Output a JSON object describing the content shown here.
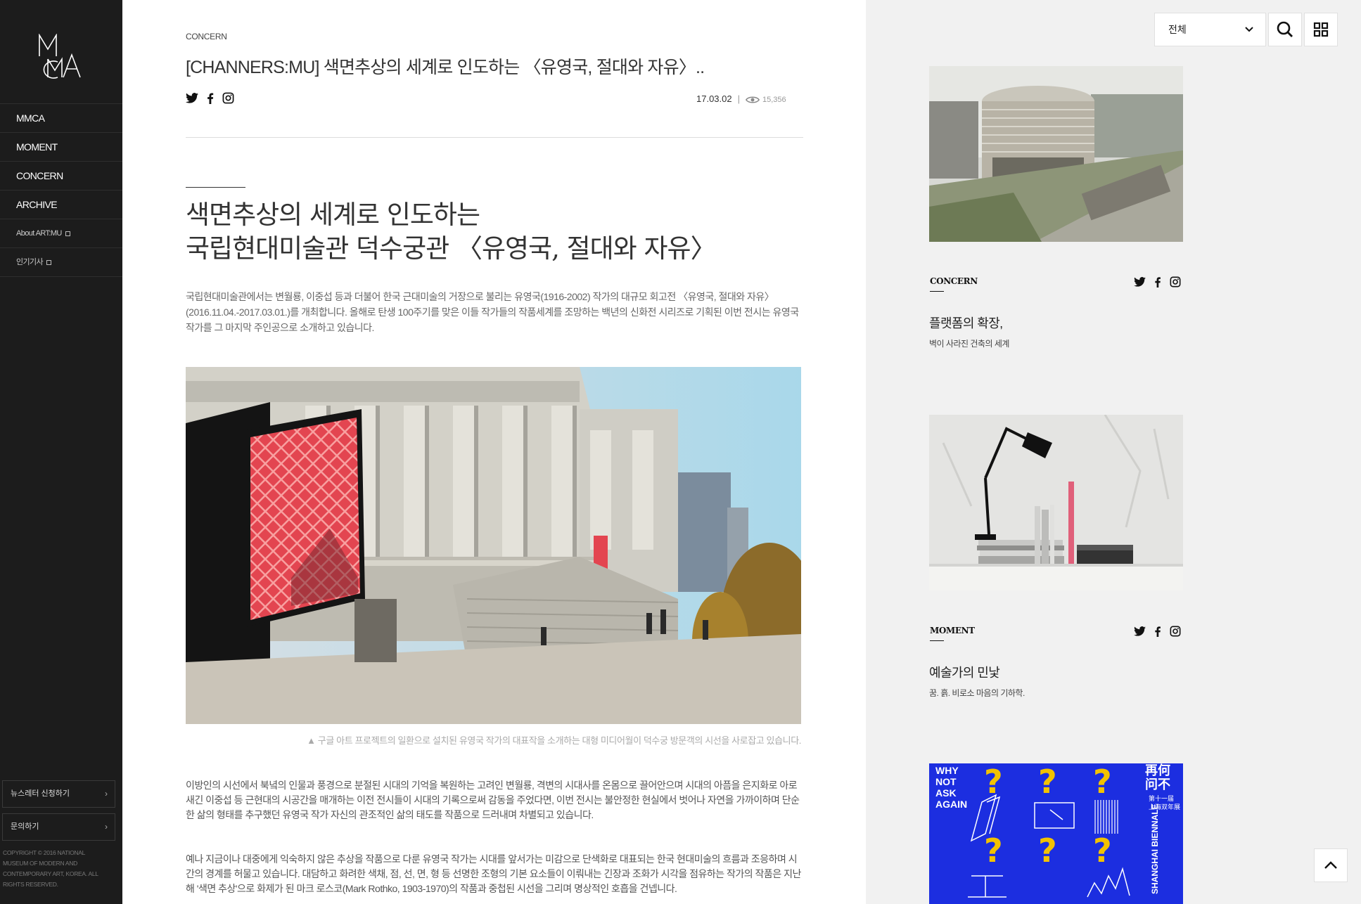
{
  "sidebar": {
    "logo_text": "MMCA",
    "nav": [
      {
        "label": "MMCA"
      },
      {
        "label": "MOMENT"
      },
      {
        "label": "CONCERN"
      },
      {
        "label": "ARCHIVE"
      },
      {
        "label": "About ART:MU"
      },
      {
        "label": "인기기사"
      }
    ],
    "newsletter": "뉴스레터 신청하기",
    "contact": "문의하기",
    "copyright": "COPYRIGHT © 2016 NATIONAL MUSEUM OF MODERN AND CONTEMPORARY ART, KOREA. ALL RIGHTS RESERVED."
  },
  "article": {
    "category": "CONCERN",
    "title": "[CHANNERS:MU] 색면추상의 세계로 인도하는 〈유영국, 절대와 자유〉..",
    "date": "17.03.02",
    "date_sep": "|",
    "views": "15,356",
    "headline_line1": "색면추상의 세계로 인도하는",
    "headline_line2": "국립현대미술관 덕수궁관 〈유영국, 절대와 자유〉",
    "lead": "국립현대미술관에서는 변월룡, 이중섭 등과 더불어 한국 근대미술의 거장으로 불리는 유영국(1916-2002) 작가의 대규모 회고전 〈유영국, 절대와 자유〉(2016.11.04.-2017.03.01.)를 개최합니다. 올해로 탄생 100주기를 맞은 이들 작가들의 작품세계를 조망하는 백년의 신화전 시리즈로 기획된 이번 전시는 유영국 작가를 그 마지막 주인공으로 소개하고 있습니다.",
    "caption": "▲ 구글 아트 프로젝트의 일환으로 설치된 유영국 작가의 대표작을 소개하는 대형 미디어월이 덕수궁 방문객의 시선을 사로잡고 있습니다.",
    "para1": "이방인의 시선에서 북녘의 인물과 풍경으로 분절된 시대의 기억을 복원하는 고려인 변월룡, 격변의 시대사를 온몸으로 끌어안으며 시대의 아픔을 은지화로 아로새긴 이중섭 등 근현대의 시공간을 매개하는 이전 전시들이 시대의 기록으로써 감동을 주었다면, 이번 전시는 불안정한 현실에서 벗어나 자연을 가까이하며 단순한 삶의 형태를 추구했던 유영국 작가 자신의 관조적인 삶의 태도를 작품으로 드러내며 차별되고 있습니다.",
    "para2": "예나 지금이나 대중에게 익숙하지 않은 추상을 작품으로 다룬 유영국 작가는 시대를 앞서가는 미감으로 단색화로 대표되는 한국 현대미술의 흐름과 조응하며 시간의 경계를 허물고 있습니다. 대담하고 화려한 색채, 점, 선, 면, 형 등 선명한 조형의 기본 요소들이 이뤄내는 긴장과 조화가 시각을 점유하는 작가의 작품은 지난해 '색면 추상'으로 화제가 된 마크 로스코(Mark Rothko, 1903-1970)의 작품과 중첩된 시선을 그리며 명상적인 호흡을 건넵니다."
  },
  "right": {
    "filter_label": "전체",
    "cards": [
      {
        "category": "CONCERN",
        "title": "플랫폼의 확장,",
        "subtitle": "벽이 사라진 건축의 세계"
      },
      {
        "category": "MOMENT",
        "title": "예술가의 민낯",
        "subtitle": "꿈. 흙. 비로소 마음의 기하학."
      },
      {
        "poster_lines": [
          "WHY",
          "NOT",
          "ASK",
          "AGAIN"
        ],
        "poster_cn": [
          "再何",
          "问不"
        ],
        "poster_cn_small": [
          "第十一届",
          "上海双年展"
        ],
        "poster_side": "SHANGHAI BIENNALE"
      }
    ]
  },
  "colors": {
    "sidebar_bg": "#1c1c1c",
    "right_bg": "#f1f1f1",
    "poster_blue": "#1c2ee0",
    "poster_yellow": "#f2c200"
  }
}
